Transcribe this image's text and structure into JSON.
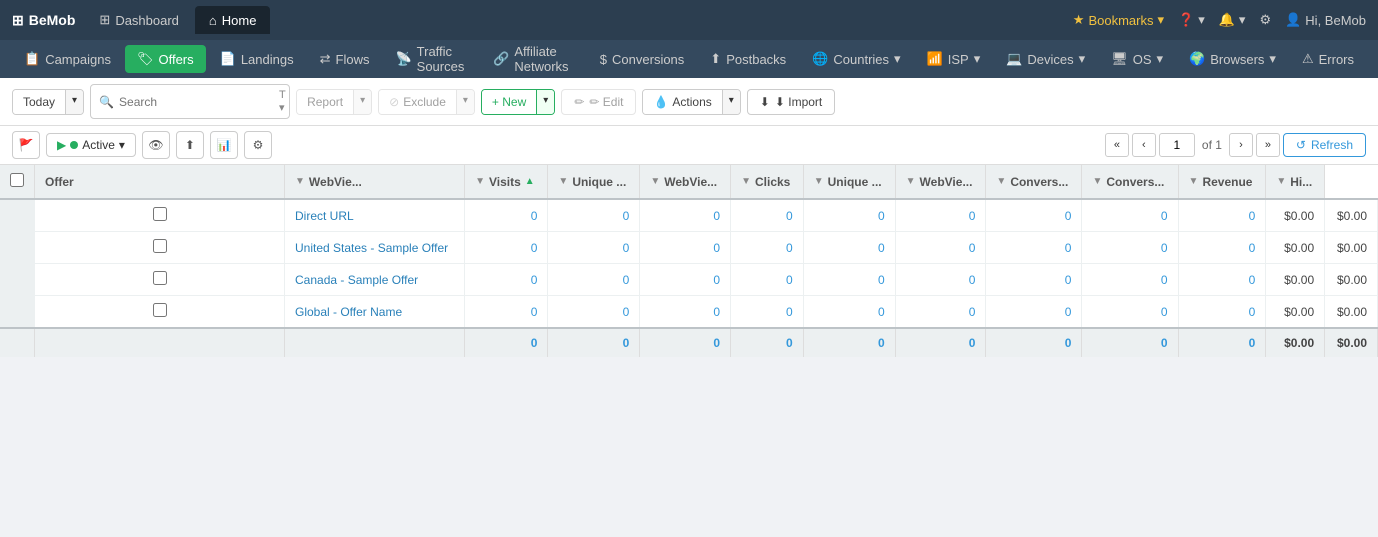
{
  "brand": {
    "icon": "⊞",
    "name": "BeMob"
  },
  "topNav": {
    "tabs": [
      {
        "label": "Dashboard",
        "icon": "⊞",
        "active": false
      },
      {
        "label": "Home",
        "icon": "⌂",
        "active": true
      }
    ],
    "right": {
      "bookmarks_label": "Bookmarks",
      "help_icon": "?",
      "notifications_icon": "🔔",
      "settings_icon": "⚙",
      "user_label": "Hi, BeMob"
    }
  },
  "secNav": {
    "items": [
      {
        "label": "Campaigns",
        "icon": "📋"
      },
      {
        "label": "Offers",
        "icon": "🏷",
        "active": true
      },
      {
        "label": "Landings",
        "icon": "📄"
      },
      {
        "label": "Flows",
        "icon": "⇄"
      },
      {
        "label": "Traffic Sources",
        "icon": "📡"
      },
      {
        "label": "Affiliate Networks",
        "icon": "🔗"
      },
      {
        "label": "Conversions",
        "icon": "$"
      },
      {
        "label": "Postbacks",
        "icon": "⬆"
      },
      {
        "label": "Countries",
        "icon": "🌐",
        "has_arrow": true
      },
      {
        "label": "ISP",
        "icon": "📶",
        "has_arrow": true
      },
      {
        "label": "Devices",
        "icon": "💻",
        "has_arrow": true
      },
      {
        "label": "OS",
        "icon": "🖥",
        "has_arrow": true
      },
      {
        "label": "Browsers",
        "icon": "🌍",
        "has_arrow": true
      },
      {
        "label": "Errors",
        "icon": "⚠"
      }
    ]
  },
  "toolbar": {
    "today_label": "Today",
    "search_placeholder": "Search",
    "report_label": "Report",
    "exclude_label": "Exclude",
    "new_label": "+ New",
    "edit_label": "✏ Edit",
    "actions_label": "Actions",
    "import_label": "⬇ Import"
  },
  "subToolbar": {
    "flag_icon": "🚩",
    "play_icon": "▶",
    "active_label": "Active",
    "eye_icon": "👁",
    "share_icon": "⬆",
    "chart_icon": "📊",
    "settings_icon": "⚙",
    "page_current": "1",
    "page_of": "of 1",
    "refresh_label": "Refresh"
  },
  "table": {
    "columns": [
      {
        "key": "offer",
        "label": "Offer",
        "sortable": false
      },
      {
        "key": "webviews",
        "label": "WebVie...",
        "sortable": true
      },
      {
        "key": "visits",
        "label": "Visits",
        "sortable": true,
        "sorted": true
      },
      {
        "key": "unique_visits",
        "label": "Unique ...",
        "sortable": true
      },
      {
        "key": "webviews2",
        "label": "WebVie...",
        "sortable": true
      },
      {
        "key": "clicks",
        "label": "Clicks",
        "sortable": true
      },
      {
        "key": "unique_clicks",
        "label": "Unique ...",
        "sortable": true
      },
      {
        "key": "webviews3",
        "label": "WebVie...",
        "sortable": true
      },
      {
        "key": "conversions",
        "label": "Convers...",
        "sortable": true
      },
      {
        "key": "conversions2",
        "label": "Convers...",
        "sortable": true
      },
      {
        "key": "revenue",
        "label": "Revenue",
        "sortable": true
      },
      {
        "key": "hi",
        "label": "Hi...",
        "sortable": true
      }
    ],
    "rows": [
      {
        "offer": "Direct URL",
        "webviews": "0",
        "visits": "0",
        "unique_visits": "0",
        "webviews2": "0",
        "clicks": "0",
        "unique_clicks": "0",
        "webviews3": "0",
        "conversions": "0",
        "conversions2": "0",
        "revenue": "$0.00",
        "hi": "$0.00"
      },
      {
        "offer": "United States - Sample Offer",
        "webviews": "0",
        "visits": "0",
        "unique_visits": "0",
        "webviews2": "0",
        "clicks": "0",
        "unique_clicks": "0",
        "webviews3": "0",
        "conversions": "0",
        "conversions2": "0",
        "revenue": "$0.00",
        "hi": "$0.00"
      },
      {
        "offer": "Canada - Sample Offer",
        "webviews": "0",
        "visits": "0",
        "unique_visits": "0",
        "webviews2": "0",
        "clicks": "0",
        "unique_clicks": "0",
        "webviews3": "0",
        "conversions": "0",
        "conversions2": "0",
        "revenue": "$0.00",
        "hi": "$0.00"
      },
      {
        "offer": "Global - Offer Name",
        "webviews": "0",
        "visits": "0",
        "unique_visits": "0",
        "webviews2": "0",
        "clicks": "0",
        "unique_clicks": "0",
        "webviews3": "0",
        "conversions": "0",
        "conversions2": "0",
        "revenue": "$0.00",
        "hi": "$0.00"
      }
    ],
    "footer": {
      "webviews": "0",
      "visits": "0",
      "unique_visits": "0",
      "webviews2": "0",
      "clicks": "0",
      "unique_clicks": "0",
      "webviews3": "0",
      "conversions": "0",
      "conversions2": "0",
      "revenue": "$0.00",
      "hi": "$0.00"
    }
  },
  "colors": {
    "brand_dark": "#2c3e50",
    "brand_mid": "#34495e",
    "green": "#27ae60",
    "blue": "#3498db"
  }
}
